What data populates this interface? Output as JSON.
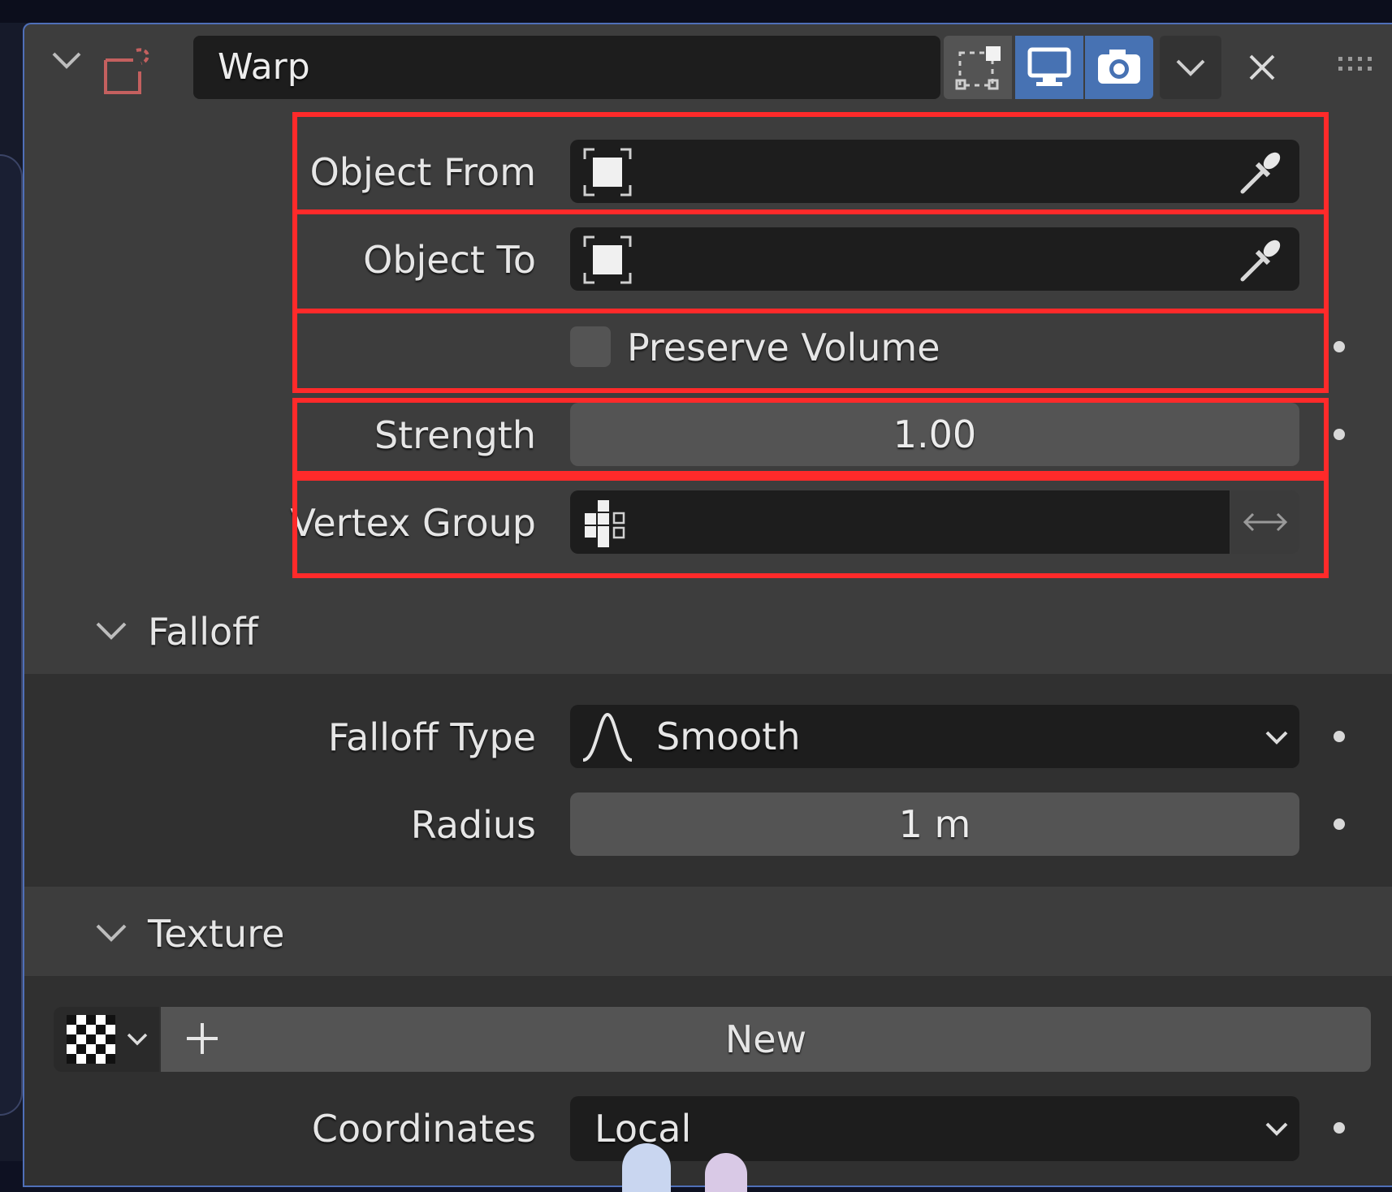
{
  "modifier": {
    "name": "Warp",
    "header_buttons": [
      "edit-mode-icon",
      "realtime-display-icon",
      "render-camera-icon",
      "dropdown-chevron-icon",
      "close-icon",
      "drag-handle-icon"
    ]
  },
  "fields": {
    "object_from": {
      "label": "Object From",
      "value": ""
    },
    "object_to": {
      "label": "Object To",
      "value": ""
    },
    "preserve_volume": {
      "label": "Preserve Volume",
      "checked": false
    },
    "strength": {
      "label": "Strength",
      "value": "1.00"
    },
    "vertex_group": {
      "label": "Vertex Group",
      "value": ""
    }
  },
  "falloff": {
    "title": "Falloff",
    "type_label": "Falloff Type",
    "type_value": "Smooth",
    "radius_label": "Radius",
    "radius_value": "1 m"
  },
  "texture": {
    "title": "Texture",
    "new_label": "New",
    "coordinates_label": "Coordinates",
    "coordinates_value": "Local"
  },
  "colors": {
    "active_blue": "#4772b3",
    "highlight_red": "#ff2a2a",
    "panel_bg": "#3d3d3d",
    "field_dark": "#1d1d1d"
  }
}
